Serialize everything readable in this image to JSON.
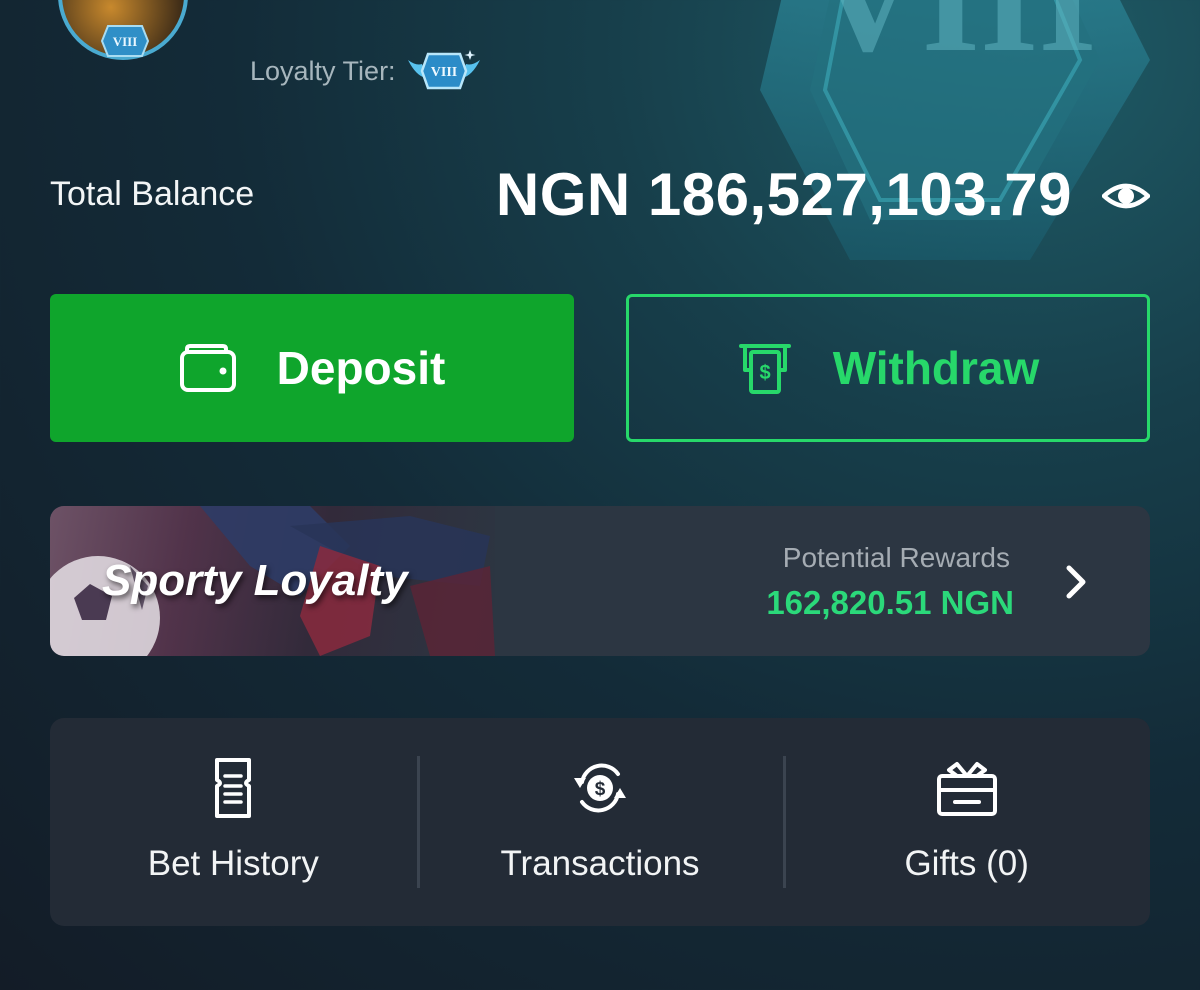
{
  "profile": {
    "avatar_badge_text": "VIII",
    "loyalty_tier_label": "Loyalty Tier:",
    "loyalty_tier_badge_text": "VIII",
    "background_badge_text": "VIII"
  },
  "balance": {
    "label": "Total Balance",
    "amount": "NGN 186,527,103.79",
    "visibility_icon": "eye-icon"
  },
  "actions": {
    "deposit_label": "Deposit",
    "deposit_icon": "wallet-icon",
    "withdraw_label": "Withdraw",
    "withdraw_icon": "cash-withdraw-icon"
  },
  "loyalty": {
    "title": "Sporty Loyalty",
    "rewards_label": "Potential Rewards",
    "rewards_value": "162,820.51 NGN",
    "chevron_icon": "chevron-right-icon"
  },
  "shortcuts": [
    {
      "label": "Bet History",
      "icon": "receipt-icon"
    },
    {
      "label": "Transactions",
      "icon": "dollar-exchange-icon"
    },
    {
      "label": "Gifts (0)",
      "icon": "gift-icon"
    }
  ],
  "colors": {
    "deposit_bg": "#0fa52c",
    "withdraw_accent": "#27d86a",
    "rewards_value": "#2bd97a",
    "background": "#132b38"
  }
}
